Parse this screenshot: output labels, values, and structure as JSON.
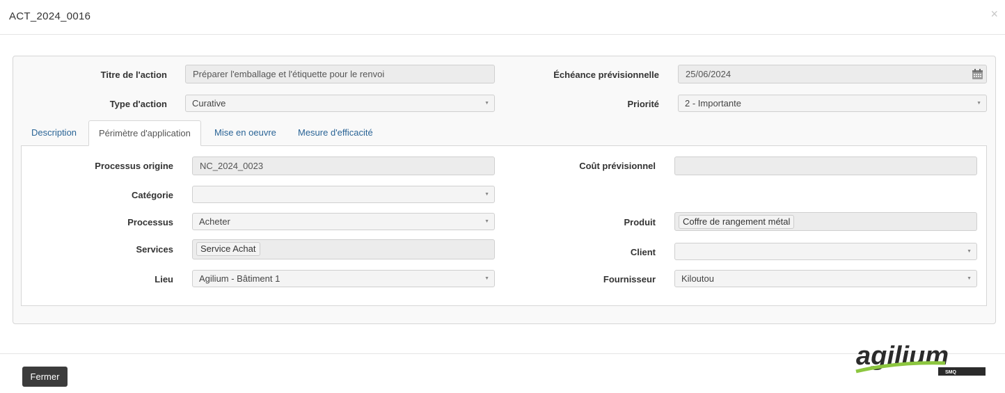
{
  "modal": {
    "title": "ACT_2024_0016",
    "close_glyph": "×",
    "close_button": "Fermer"
  },
  "header_fields": {
    "titre_label": "Titre de l'action",
    "titre_value": "Préparer l'emballage et l'étiquette pour le renvoi",
    "echeance_label": "Échéance prévisionnelle",
    "echeance_value": "25/06/2024",
    "type_label": "Type d'action",
    "type_value": "Curative",
    "priorite_label": "Priorité",
    "priorite_value": "2 - Importante"
  },
  "tabs": [
    {
      "label": "Description",
      "active": false
    },
    {
      "label": "Périmètre d'application",
      "active": true
    },
    {
      "label": "Mise en oeuvre",
      "active": false
    },
    {
      "label": "Mesure d'efficacité",
      "active": false
    }
  ],
  "perimetre": {
    "processus_origine_label": "Processus origine",
    "processus_origine_value": "NC_2024_0023",
    "cout_label": "Coût prévisionnel",
    "cout_value": "",
    "categorie_label": "Catégorie",
    "categorie_value": "",
    "processus_label": "Processus",
    "processus_value": "Acheter",
    "produit_label": "Produit",
    "produit_tag": "Coffre de rangement métal",
    "services_label": "Services",
    "services_tag": "Service Achat",
    "client_label": "Client",
    "client_value": "",
    "lieu_label": "Lieu",
    "lieu_value": "Agilium - Bâtiment 1",
    "fournisseur_label": "Fournisseur",
    "fournisseur_value": "Kiloutou"
  },
  "logo": {
    "text": "agilium",
    "badge": "SMQ",
    "brand_dark": "#2b2b2b",
    "brand_green": "#8cc63f"
  },
  "colors": {
    "tab_link": "#2a6496",
    "button_bg": "#3c3c3c"
  },
  "icons": {
    "calendar": "calendar-icon",
    "caret": "caret-down-icon",
    "close": "close-icon"
  }
}
